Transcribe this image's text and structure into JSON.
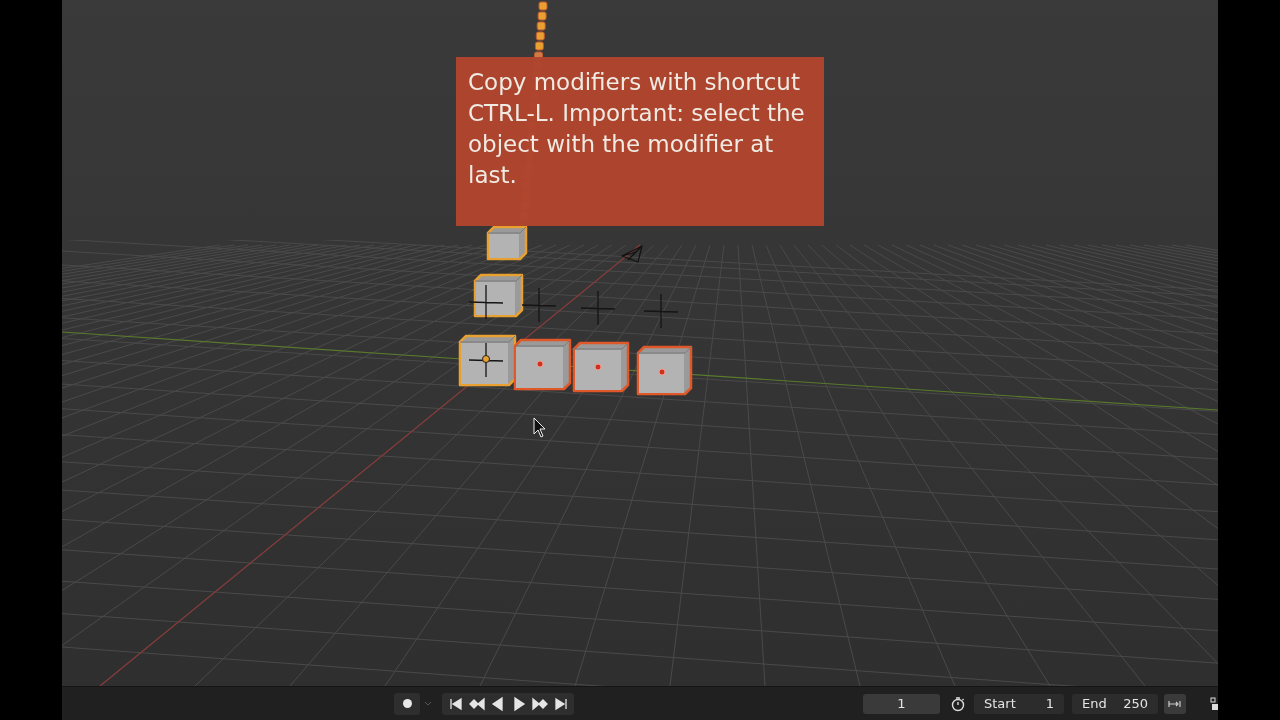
{
  "viewport": {
    "annotation": "Copy modifiers with shortcut CTRL-L. Important: select the object with the modifier at last."
  },
  "timeline": {
    "record_button": {
      "on": false
    },
    "playback_controls": [
      {
        "kind": "jump-start"
      },
      {
        "kind": "prev-key"
      },
      {
        "kind": "play-reverse"
      },
      {
        "kind": "play"
      },
      {
        "kind": "next-key"
      },
      {
        "kind": "jump-end"
      }
    ],
    "current_frame": "1",
    "start": {
      "label": "Start",
      "value": "1"
    },
    "end": {
      "label": "End",
      "value": "250"
    }
  }
}
